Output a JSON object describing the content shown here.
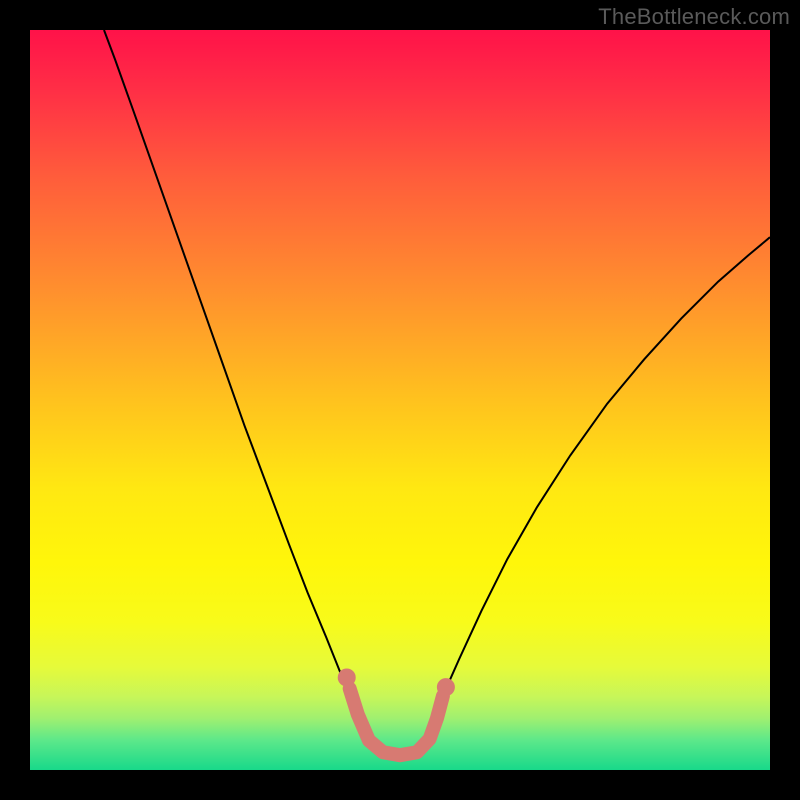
{
  "watermark": "TheBottleneck.com",
  "chart_data": {
    "type": "line",
    "title": "",
    "xlabel": "",
    "ylabel": "",
    "xlim": [
      0,
      100
    ],
    "ylim": [
      0,
      100
    ],
    "background_gradient": {
      "stops": [
        {
          "offset": 0.0,
          "color": "#ff1249"
        },
        {
          "offset": 0.08,
          "color": "#ff2e46"
        },
        {
          "offset": 0.2,
          "color": "#ff5d3b"
        },
        {
          "offset": 0.35,
          "color": "#ff8f2e"
        },
        {
          "offset": 0.5,
          "color": "#ffc21e"
        },
        {
          "offset": 0.62,
          "color": "#ffe812"
        },
        {
          "offset": 0.72,
          "color": "#fff60a"
        },
        {
          "offset": 0.8,
          "color": "#f8fb1a"
        },
        {
          "offset": 0.86,
          "color": "#e6fa3a"
        },
        {
          "offset": 0.9,
          "color": "#c8f658"
        },
        {
          "offset": 0.93,
          "color": "#a0f070"
        },
        {
          "offset": 0.96,
          "color": "#5ce88a"
        },
        {
          "offset": 1.0,
          "color": "#18d98a"
        }
      ]
    },
    "series": [
      {
        "name": "left-curve",
        "color": "#000000",
        "width": 2.0,
        "points": [
          {
            "x": 10.0,
            "y": 100.0
          },
          {
            "x": 11.5,
            "y": 96.0
          },
          {
            "x": 14.0,
            "y": 89.0
          },
          {
            "x": 17.0,
            "y": 80.5
          },
          {
            "x": 20.0,
            "y": 72.0
          },
          {
            "x": 23.0,
            "y": 63.5
          },
          {
            "x": 26.0,
            "y": 55.0
          },
          {
            "x": 29.0,
            "y": 46.5
          },
          {
            "x": 32.0,
            "y": 38.5
          },
          {
            "x": 35.0,
            "y": 30.5
          },
          {
            "x": 37.5,
            "y": 24.0
          },
          {
            "x": 40.0,
            "y": 18.0
          },
          {
            "x": 42.0,
            "y": 13.0
          },
          {
            "x": 43.5,
            "y": 9.5
          },
          {
            "x": 44.7,
            "y": 7.0
          }
        ]
      },
      {
        "name": "right-curve",
        "color": "#000000",
        "width": 2.0,
        "points": [
          {
            "x": 54.5,
            "y": 7.0
          },
          {
            "x": 56.0,
            "y": 10.5
          },
          {
            "x": 58.0,
            "y": 15.0
          },
          {
            "x": 61.0,
            "y": 21.5
          },
          {
            "x": 64.5,
            "y": 28.5
          },
          {
            "x": 68.5,
            "y": 35.5
          },
          {
            "x": 73.0,
            "y": 42.5
          },
          {
            "x": 78.0,
            "y": 49.5
          },
          {
            "x": 83.0,
            "y": 55.5
          },
          {
            "x": 88.0,
            "y": 61.0
          },
          {
            "x": 93.0,
            "y": 66.0
          },
          {
            "x": 97.0,
            "y": 69.5
          },
          {
            "x": 100.0,
            "y": 72.0
          }
        ]
      },
      {
        "name": "valley-highlight",
        "color": "#d77a72",
        "width": 14,
        "linecap": "round",
        "points": [
          {
            "x": 43.2,
            "y": 11.0
          },
          {
            "x": 44.3,
            "y": 7.5
          },
          {
            "x": 45.8,
            "y": 4.0
          },
          {
            "x": 47.7,
            "y": 2.4
          },
          {
            "x": 50.0,
            "y": 2.0
          },
          {
            "x": 52.3,
            "y": 2.4
          },
          {
            "x": 54.0,
            "y": 4.2
          },
          {
            "x": 55.0,
            "y": 7.0
          },
          {
            "x": 55.8,
            "y": 10.0
          }
        ]
      },
      {
        "name": "valley-dot-left",
        "color": "#d77a72",
        "type_hint": "marker",
        "radius": 9,
        "point": {
          "x": 42.8,
          "y": 12.5
        }
      },
      {
        "name": "valley-dot-right",
        "color": "#d77a72",
        "type_hint": "marker",
        "radius": 9,
        "point": {
          "x": 56.2,
          "y": 11.2
        }
      }
    ]
  }
}
